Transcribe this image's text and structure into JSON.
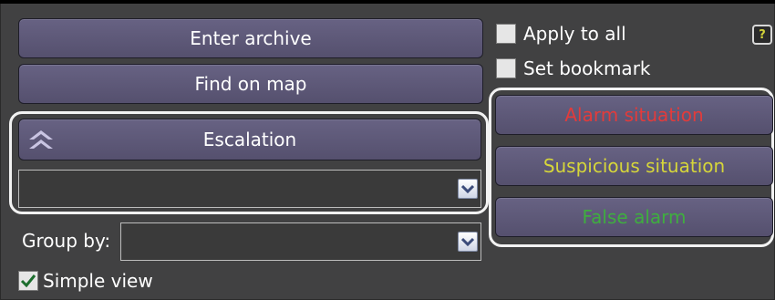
{
  "buttons": {
    "enter_archive": "Enter archive",
    "find_on_map": "Find on map",
    "escalation": "Escalation",
    "alarm_situation": "Alarm situation",
    "suspicious_situation": "Suspicious situation",
    "false_alarm": "False alarm"
  },
  "checkboxes": {
    "apply_to_all": {
      "label": "Apply to all",
      "checked": false
    },
    "set_bookmark": {
      "label": "Set bookmark",
      "checked": false
    },
    "simple_view": {
      "label": "Simple view",
      "checked": true
    }
  },
  "group_by": {
    "label": "Group by:",
    "value": ""
  },
  "escalation_select": {
    "value": ""
  },
  "help_label": "?",
  "colors": {
    "alarm": "#e23b3b",
    "suspicious": "#d6d63a",
    "false_alarm": "#3fae3f",
    "button_bg": "#5e5979",
    "outline": "#f2f2f2"
  },
  "icons": {
    "escalation": "double-chevron-up-icon",
    "dropdown": "chevron-down-icon",
    "check": "checkmark-icon",
    "help": "question-mark-icon"
  }
}
